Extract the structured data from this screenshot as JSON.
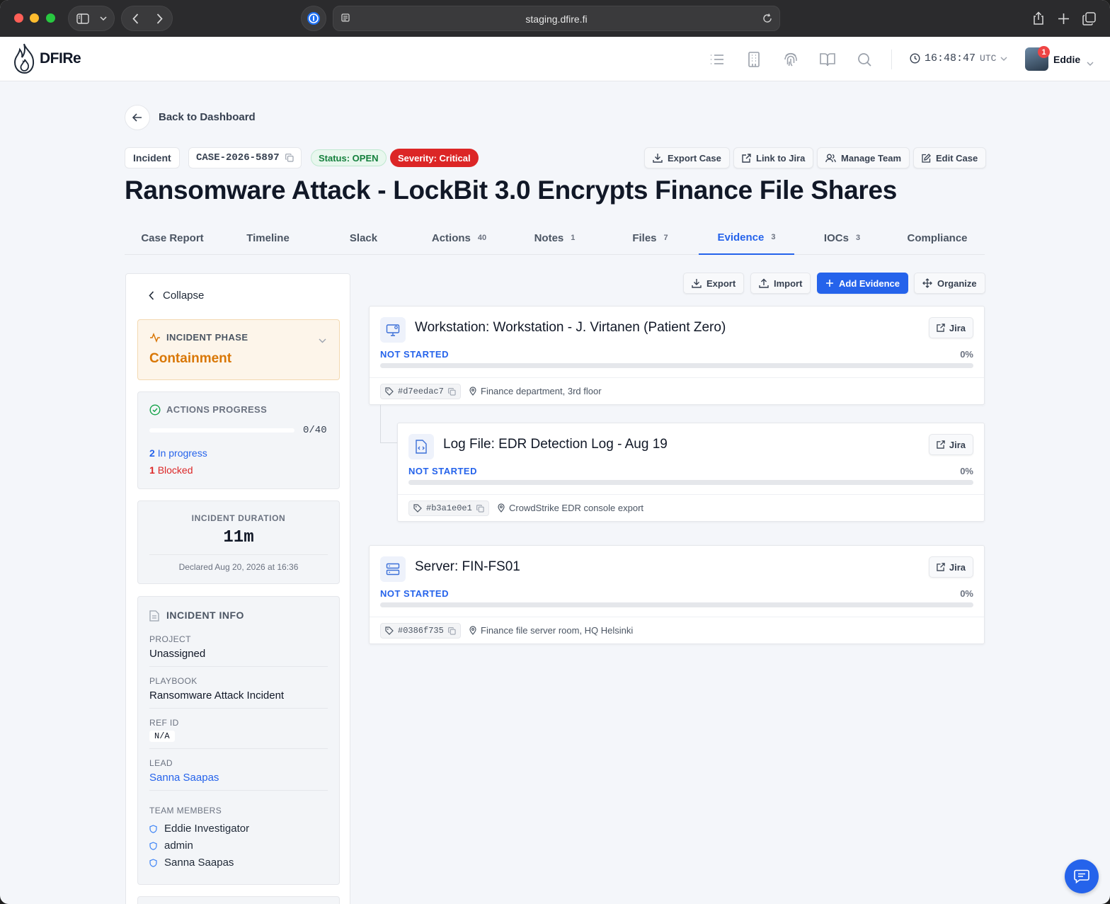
{
  "browser": {
    "url": "staging.dfire.fi"
  },
  "app": {
    "logo_text": "DFIRe",
    "clock": "16:48:47",
    "clock_tz": "UTC",
    "notification_count": "1",
    "user_name": "Eddie",
    "header_icons": [
      "list-icon",
      "building-icon",
      "fingerprint-icon",
      "book-icon",
      "search-icon"
    ]
  },
  "nav": {
    "back_label": "Back to Dashboard"
  },
  "case": {
    "type": "Incident",
    "case_id": "CASE-2026-5897",
    "status": "Status: OPEN",
    "severity": "Severity: Critical",
    "title": "Ransomware Attack - LockBit 3.0 Encrypts Finance File Shares",
    "actions": {
      "export": "Export Case",
      "jira": "Link to Jira",
      "team": "Manage Team",
      "edit": "Edit Case"
    }
  },
  "tabs": [
    {
      "label": "Case Report",
      "count": ""
    },
    {
      "label": "Timeline",
      "count": ""
    },
    {
      "label": "Slack",
      "count": ""
    },
    {
      "label": "Actions",
      "count": "40"
    },
    {
      "label": "Notes",
      "count": "1"
    },
    {
      "label": "Files",
      "count": "7"
    },
    {
      "label": "Evidence",
      "count": "3"
    },
    {
      "label": "IOCs",
      "count": "3"
    },
    {
      "label": "Compliance",
      "count": ""
    }
  ],
  "active_tab": "Evidence",
  "sidebar": {
    "collapse_label": "Collapse",
    "phase": {
      "label": "INCIDENT PHASE",
      "value": "Containment"
    },
    "progress": {
      "label": "ACTIONS PROGRESS",
      "count": "0/40",
      "fraction": 0,
      "in_progress_num": "2",
      "in_progress_label": "In progress",
      "blocked_num": "1",
      "blocked_label": "Blocked"
    },
    "duration": {
      "label": "INCIDENT DURATION",
      "value": "11m",
      "declared": "Declared Aug 20, 2026 at 16:36"
    },
    "info": {
      "heading": "INCIDENT INFO",
      "project_label": "PROJECT",
      "project": "Unassigned",
      "playbook_label": "PLAYBOOK",
      "playbook": "Ransomware Attack Incident",
      "refid_label": "REF ID",
      "refid": "N/A",
      "lead_label": "LEAD",
      "lead": "Sanna Saapas",
      "team_label": "TEAM MEMBERS",
      "team": [
        "Eddie Investigator",
        "admin",
        "Sanna Saapas"
      ]
    }
  },
  "evidence_toolbar": {
    "export": "Export",
    "import": "Import",
    "add": "Add Evidence",
    "organize": "Organize"
  },
  "evidence": [
    {
      "icon": "workstation-icon",
      "title": "Workstation: Workstation - J. Virtanen (Patient Zero)",
      "status": "NOT STARTED",
      "progress": "0%",
      "hash": "#d7eedac7",
      "location": "Finance department, 3rd floor",
      "jira": "Jira"
    },
    {
      "icon": "log-file-icon",
      "title": "Log File: EDR Detection Log - Aug 19",
      "status": "NOT STARTED",
      "progress": "0%",
      "hash": "#b3a1e0e1",
      "location": "CrowdStrike EDR console export",
      "jira": "Jira"
    },
    {
      "icon": "server-icon",
      "title": "Server: FIN-FS01",
      "status": "NOT STARTED",
      "progress": "0%",
      "hash": "#0386f735",
      "location": "Finance file server room, HQ Helsinki",
      "jira": "Jira"
    }
  ],
  "colors": {
    "accent": "#2563eb",
    "severity": "#dc2626",
    "phase": "#d97706",
    "status_open": "#15803d"
  }
}
